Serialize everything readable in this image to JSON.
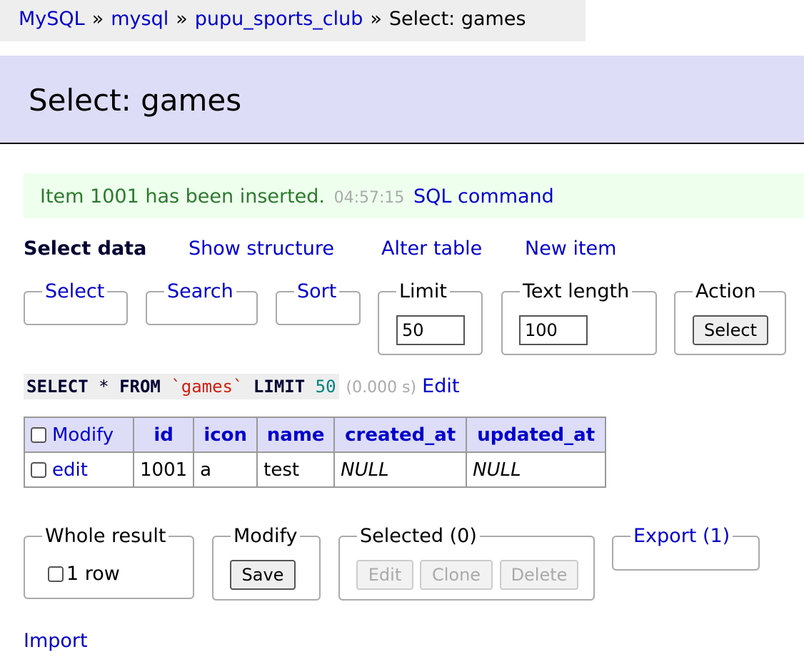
{
  "breadcrumb": {
    "items": [
      "MySQL",
      "mysql",
      "pupu_sports_club"
    ],
    "separator": "»",
    "current": "Select: games"
  },
  "page_title": "Select: games",
  "message": {
    "text": "Item 1001 has been inserted.",
    "time": "04:57:15",
    "link": "SQL command"
  },
  "nav": {
    "select_data": "Select data",
    "show_structure": "Show structure",
    "alter_table": "Alter table",
    "new_item": "New item"
  },
  "filters": {
    "select": "Select",
    "search": "Search",
    "sort": "Sort",
    "limit_label": "Limit",
    "limit_value": "50",
    "text_length_label": "Text length",
    "text_length_value": "100",
    "action_label": "Action",
    "action_button": "Select"
  },
  "query": {
    "kw_select": "SELECT",
    "star": "*",
    "kw_from": "FROM",
    "table": "`games`",
    "kw_limit": "LIMIT",
    "limit": "50",
    "time": "(0.000 s)",
    "edit_link": "Edit"
  },
  "table": {
    "modify_header": "Modify",
    "columns": [
      "id",
      "icon",
      "name",
      "created_at",
      "updated_at"
    ],
    "rows": [
      {
        "edit": "edit",
        "id": "1001",
        "icon": "a",
        "name": "test",
        "created_at": "NULL",
        "updated_at": "NULL"
      }
    ]
  },
  "bottom": {
    "whole_result_label": "Whole result",
    "whole_result_value": "1 row",
    "modify_label": "Modify",
    "save_button": "Save",
    "selected_label": "Selected (0)",
    "edit_button": "Edit",
    "clone_button": "Clone",
    "delete_button": "Delete",
    "export_link": "Export (1)",
    "import_link": "Import"
  },
  "colors": {
    "link": "#0000cc",
    "header_bg": "#ddddf8",
    "message_bg": "#eeffee",
    "message_text": "#2c7a2c"
  }
}
